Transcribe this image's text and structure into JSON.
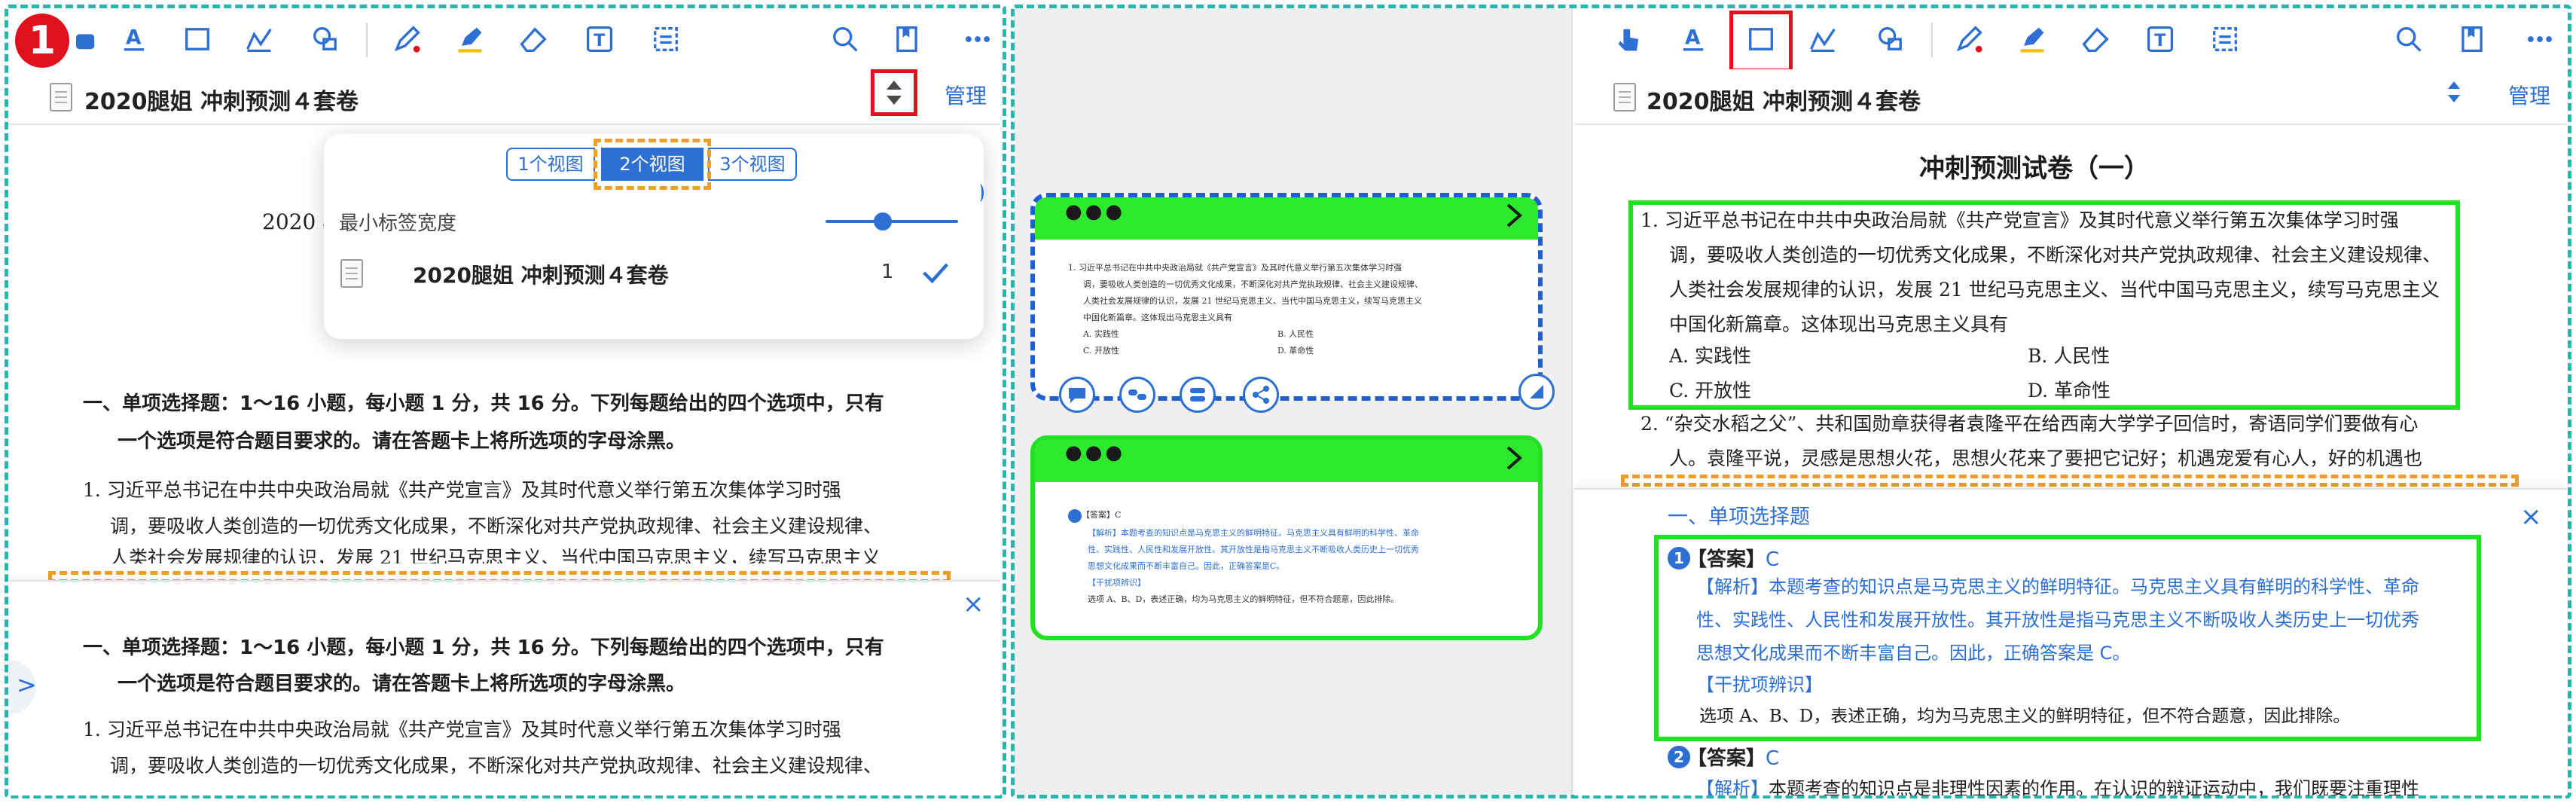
{
  "badges": [
    "1",
    "2"
  ],
  "colors": {
    "accent": "#2d6fd3",
    "highlight_red": "#e0101e",
    "highlight_green": "#22e022",
    "frame_teal": "#25b8b0",
    "orange": "#f0a020"
  },
  "toolbar_icons": [
    "pointer-icon",
    "text-underline-icon",
    "rectangle-select-icon",
    "chart-icon",
    "shapes-icon",
    "pen-icon",
    "highlighter-icon",
    "eraser-icon",
    "textbox-icon",
    "ocr-icon",
    "search-icon",
    "bookmark-icon",
    "more-icon"
  ],
  "left": {
    "doc_title": "2020腿姐 冲刺预测４套卷",
    "manage": "管理",
    "popup": {
      "views": [
        "1个视图",
        "2个视图",
        "3个视图"
      ],
      "active_view": "2个视图",
      "min_tab_width": "最小标签宽度",
      "tab_item": "2020腿姐 冲刺预测４套卷",
      "tab_count": "1"
    },
    "year_fragment": "2020 年",
    "section_heading_1": "一、单项选择题：1～16 小题，每小题 1 分，共 16 分。下列每题给出的四个选项中，只有",
    "section_heading_2": "一个选项是符合题目要求的。请在答题卡上将所选项的字母涂黑。",
    "q1_line1": "1. 习近平总书记在中共中央政治局就《共产党宣言》及其时代意义举行第五次集体学习时强",
    "q1_line2": "调，要吸收人类创造的一切优秀文化成果，不断深化对共产党执政规律、社会主义建设规律、",
    "q1_line3": "人类社会发展规律的认识，发展 21 世纪马克思主义、当代中国马克思主义，续写马克思主义",
    "bottom_heading_1": "一、单项选择题：1～16 小题，每小题 1 分，共 16 分。下列每题给出的四个选项中，只有",
    "bottom_heading_2": "一个选项是符合题目要求的。请在答题卡上将所选项的字母涂黑。",
    "bottom_q1_line1": "1. 习近平总书记在中共中央政治局就《共产党宣言》及其时代意义举行第五次集体学习时强",
    "bottom_q1_line2": "调，要吸收人类创造的一切优秀文化成果，不断深化对共产党执政规律、社会主义建设规律、",
    "close": "×",
    "side_arrow": ">"
  },
  "middle": {
    "card1": {
      "dots": "●●●",
      "lines": [
        "1. 习近平总书记在中共中央政治局就《共产党宣言》及其时代意义举行第五次集体学习时强",
        "调，要吸收人类创造的一切优秀文化成果，不断深化对共产党执政规律、社会主义建设规律、",
        "人类社会发展规律的认识，发展 21 世纪马克思主义、当代中国马克思主义，续写马克思主义",
        "中国化新篇章。这体现出马克思主义具有"
      ],
      "opt_a": "A. 实践性",
      "opt_b": "B. 人民性",
      "opt_c": "C. 开放性",
      "opt_d": "D. 革命性"
    },
    "card2": {
      "dots": "●●●",
      "answer": "【答案】C",
      "analysis_1": "【解析】本题考查的知识点是马克思主义的鲜明特征。马克思主义具有鲜明的科学性、革命",
      "analysis_2": "性、实践性、人民性和发展开放性。其开放性是指马克思主义不断吸收人类历史上一切优秀",
      "analysis_3": "思想文化成果而不断丰富自己。因此，正确答案是C。",
      "distract": "【干扰项辨识】",
      "distract_text": "选项 A、B、D，表述正确，均为马克思主义的鲜明特征，但不符合题意，因此排除。"
    }
  },
  "right": {
    "doc_title": "2020腿姐 冲刺预测４套卷",
    "manage": "管理",
    "exam_title": "冲刺预测试卷（一）",
    "q1_lines": [
      "1. 习近平总书记在中共中央政治局就《共产党宣言》及其时代意义举行第五次集体学习时强",
      "调，要吸收人类创造的一切优秀文化成果，不断深化对共产党执政规律、社会主义建设规律、",
      "人类社会发展规律的认识，发展 21 世纪马克思主义、当代中国马克思主义，续写马克思主义",
      "中国化新篇章。这体现出马克思主义具有"
    ],
    "opt_a": "A. 实践性",
    "opt_b": "B. 人民性",
    "opt_c": "C. 开放性",
    "opt_d": "D. 革命性",
    "q2_line1": "2. “杂交水稻之父”、共和国勋章获得者袁隆平在给西南大学学子回信时，寄语同学们要做有心",
    "q2_line2": "人。袁隆平说，灵感是思想火花，思想火花来了要把它记好；机遇宠爱有心人，好的机遇也",
    "panel_heading": "一、单项选择题",
    "close": "×",
    "a1_num": "1",
    "a1_answer": "【答案】",
    "a1_letter": "C",
    "a1_analysis_1": "【解析】本题考查的知识点是马克思主义的鲜明特征。马克思主义具有鲜明的科学性、革命",
    "a1_analysis_2": "性、实践性、人民性和发展开放性。其开放性是指马克思主义不断吸收人类历史上一切优秀",
    "a1_analysis_3": "思想文化成果而不断丰富自己。因此，正确答案是 C。",
    "a1_distract": "【干扰项辨识】",
    "a1_distract_text": "选项 A、B、D，表述正确，均为马克思主义的鲜明特征，但不符合题意，因此排除。",
    "a2_num": "2",
    "a2_answer": "【答案】",
    "a2_letter": "C",
    "a2_analysis": "【解析】本题考查的知识点是非理性因素的作用。在认识的辩证运动中，我们既要注重理性"
  }
}
